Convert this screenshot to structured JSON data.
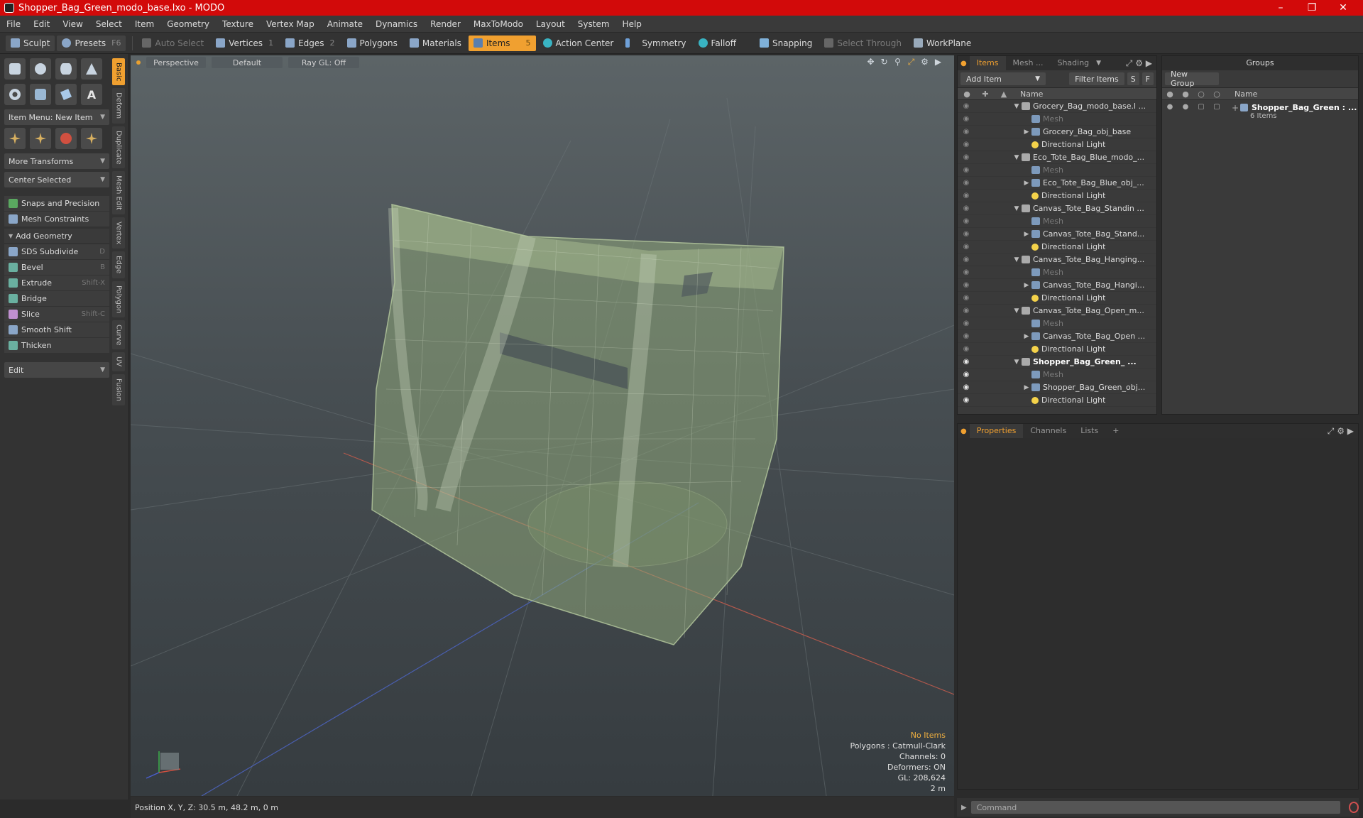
{
  "window": {
    "title": "Shopper_Bag_Green_modo_base.lxo - MODO",
    "minimize": "–",
    "maximize": "❐",
    "close": "✕"
  },
  "menu": [
    "File",
    "Edit",
    "View",
    "Select",
    "Item",
    "Geometry",
    "Texture",
    "Vertex Map",
    "Animate",
    "Dynamics",
    "Render",
    "MaxToModo",
    "Layout",
    "System",
    "Help"
  ],
  "toolbar": {
    "sculpt": "Sculpt",
    "presets": "Presets",
    "presets_key": "F6",
    "auto_select": "Auto Select",
    "vertices": "Vertices",
    "vertices_count": "1",
    "edges": "Edges",
    "edges_count": "2",
    "polygons": "Polygons",
    "materials": "Materials",
    "items": "Items",
    "items_count": "5",
    "action_center": "Action Center",
    "symmetry": "Symmetry",
    "falloff": "Falloff",
    "snapping": "Snapping",
    "select_through": "Select Through",
    "workplane": "WorkPlane"
  },
  "left_panel": {
    "item_menu": "Item Menu: New Item",
    "more_transforms": "More Transforms",
    "center_selected": "Center Selected",
    "snaps": "Snaps and Precision",
    "mesh_constraints": "Mesh Constraints",
    "add_geometry": "Add Geometry",
    "tools": [
      {
        "label": "SDS Subdivide",
        "key": "D"
      },
      {
        "label": "Bevel",
        "key": "B"
      },
      {
        "label": "Extrude",
        "key": "Shift-X"
      },
      {
        "label": "Bridge",
        "key": ""
      },
      {
        "label": "Slice",
        "key": "Shift-C"
      },
      {
        "label": "Smooth Shift",
        "key": ""
      },
      {
        "label": "Thicken",
        "key": ""
      }
    ],
    "edit": "Edit",
    "vtabs": [
      "Basic",
      "Deform",
      "Duplicate",
      "Mesh Edit",
      "Vertex",
      "Edge",
      "Polygon",
      "Curve",
      "UV",
      "Fusion"
    ]
  },
  "viewport": {
    "perspective": "Perspective",
    "default": "Default",
    "raygl": "Ray GL: Off",
    "info": {
      "no_items": "No Items",
      "polygons": "Polygons : Catmull-Clark",
      "channels": "Channels: 0",
      "deformers": "Deformers: ON",
      "gl": "GL: 208,624",
      "scale": "2 m"
    }
  },
  "status": {
    "position": "Position X, Y, Z:  30.5 m, 48.2 m, 0 m"
  },
  "items_panel": {
    "tabs": [
      "Items",
      "Mesh ...",
      "Shading"
    ],
    "add_item": "Add Item",
    "filter_items": "Filter Items",
    "s_btn": "S",
    "f_btn": "F",
    "name_col": "Name",
    "rows": [
      {
        "label": "Grocery_Bag_modo_base.l ...",
        "type": "scene",
        "indent": 0,
        "toggle": "▼",
        "eye": false
      },
      {
        "label": "Mesh",
        "type": "mesh",
        "indent": 1,
        "toggle": "",
        "eye": false,
        "dim": true
      },
      {
        "label": "Grocery_Bag_obj_base",
        "type": "mesh",
        "indent": 1,
        "toggle": "▶",
        "eye": false
      },
      {
        "label": "Directional Light",
        "type": "light",
        "indent": 1,
        "toggle": "",
        "eye": false
      },
      {
        "label": "Eco_Tote_Bag_Blue_modo_...",
        "type": "scene",
        "indent": 0,
        "toggle": "▼",
        "eye": false
      },
      {
        "label": "Mesh",
        "type": "mesh",
        "indent": 1,
        "toggle": "",
        "eye": false,
        "dim": true
      },
      {
        "label": "Eco_Tote_Bag_Blue_obj_...",
        "type": "mesh",
        "indent": 1,
        "toggle": "▶",
        "eye": false
      },
      {
        "label": "Directional Light",
        "type": "light",
        "indent": 1,
        "toggle": "",
        "eye": false
      },
      {
        "label": "Canvas_Tote_Bag_Standin ...",
        "type": "scene",
        "indent": 0,
        "toggle": "▼",
        "eye": false
      },
      {
        "label": "Mesh",
        "type": "mesh",
        "indent": 1,
        "toggle": "",
        "eye": false,
        "dim": true
      },
      {
        "label": "Canvas_Tote_Bag_Stand...",
        "type": "mesh",
        "indent": 1,
        "toggle": "▶",
        "eye": false
      },
      {
        "label": "Directional Light",
        "type": "light",
        "indent": 1,
        "toggle": "",
        "eye": false
      },
      {
        "label": "Canvas_Tote_Bag_Hanging...",
        "type": "scene",
        "indent": 0,
        "toggle": "▼",
        "eye": false
      },
      {
        "label": "Mesh",
        "type": "mesh",
        "indent": 1,
        "toggle": "",
        "eye": false,
        "dim": true
      },
      {
        "label": "Canvas_Tote_Bag_Hangi...",
        "type": "mesh",
        "indent": 1,
        "toggle": "▶",
        "eye": false
      },
      {
        "label": "Directional Light",
        "type": "light",
        "indent": 1,
        "toggle": "",
        "eye": false
      },
      {
        "label": "Canvas_Tote_Bag_Open_m...",
        "type": "scene",
        "indent": 0,
        "toggle": "▼",
        "eye": false
      },
      {
        "label": "Mesh",
        "type": "mesh",
        "indent": 1,
        "toggle": "",
        "eye": false,
        "dim": true
      },
      {
        "label": "Canvas_Tote_Bag_Open ...",
        "type": "mesh",
        "indent": 1,
        "toggle": "▶",
        "eye": false
      },
      {
        "label": "Directional Light",
        "type": "light",
        "indent": 1,
        "toggle": "",
        "eye": false
      },
      {
        "label": "Shopper_Bag_Green_  ...",
        "type": "scene",
        "indent": 0,
        "toggle": "▼",
        "eye": true,
        "bold": true
      },
      {
        "label": "Mesh",
        "type": "mesh",
        "indent": 1,
        "toggle": "",
        "eye": true,
        "dim": true
      },
      {
        "label": "Shopper_Bag_Green_obj...",
        "type": "mesh",
        "indent": 1,
        "toggle": "▶",
        "eye": true
      },
      {
        "label": "Directional Light",
        "type": "light",
        "indent": 1,
        "toggle": "",
        "eye": true
      }
    ]
  },
  "groups_panel": {
    "title": "Groups",
    "new_group": "New Group",
    "name_col": "Name",
    "group_name": "Shopper_Bag_Green :  ...",
    "group_count": "6 Items"
  },
  "props_panel": {
    "tabs": [
      "Properties",
      "Channels",
      "Lists"
    ],
    "add": "+"
  },
  "command": {
    "placeholder": "Command"
  }
}
